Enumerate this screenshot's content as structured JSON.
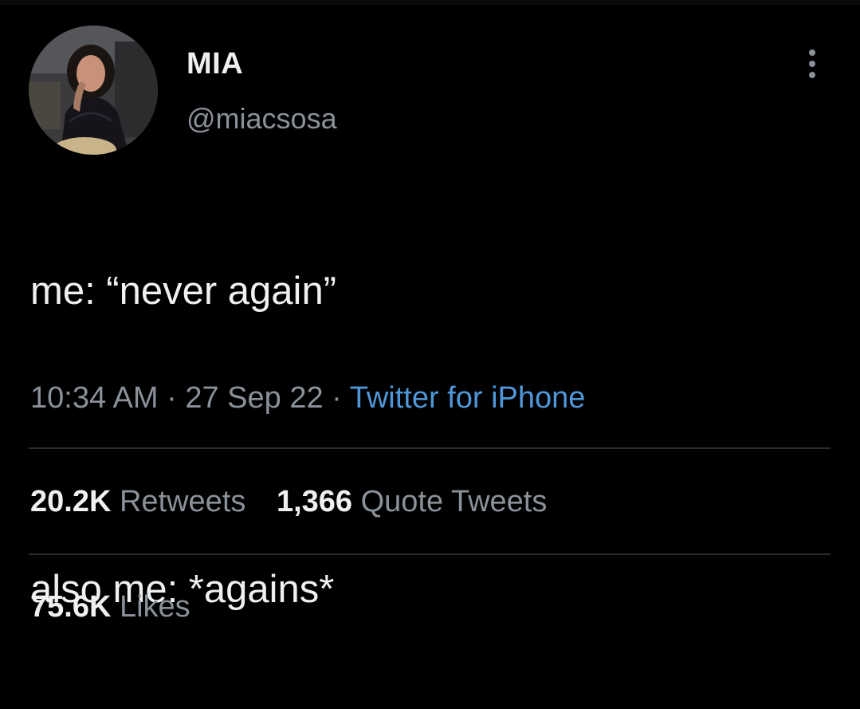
{
  "user": {
    "display_name": "MIA",
    "handle": "@miacsosa",
    "avatar_icon": "profile-photo"
  },
  "tweet": {
    "lines": [
      "me: “never again”",
      "",
      "also me: *agains*"
    ],
    "time": "10:34 AM",
    "date": "27 Sep 22",
    "separator": "·",
    "source": "Twitter for iPhone"
  },
  "stats": {
    "retweets_count": "20.2K",
    "retweets_label": "Retweets",
    "quotes_count": "1,366",
    "quotes_label": "Quote Tweets",
    "likes_count": "75.6K",
    "likes_label": "Likes"
  },
  "colors": {
    "background": "#000000",
    "text_primary": "#eef0f1",
    "text_secondary": "#8b9199",
    "link": "#4f97d8",
    "divider": "#2b2f33"
  },
  "icons": {
    "more": "more-vertical-icon"
  }
}
